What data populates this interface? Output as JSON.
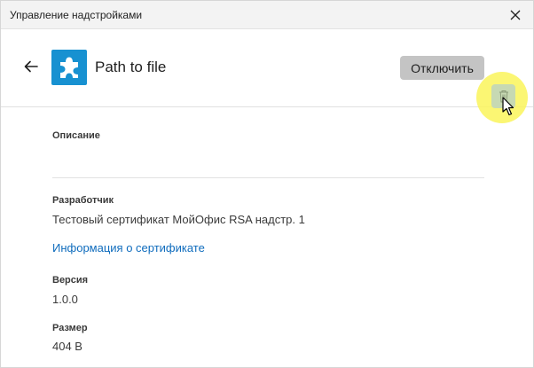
{
  "window": {
    "title": "Управление надстройками"
  },
  "header": {
    "addin_name": "Path to file",
    "disable_label": "Отключить"
  },
  "details": {
    "description_label": "Описание",
    "description_value": "",
    "developer_label": "Разработчик",
    "developer_value": "Тестовый сертификат МойОфис RSA надстр. 1",
    "certificate_link": "Информация о сертификате",
    "version_label": "Версия",
    "version_value": "1.0.0",
    "size_label": "Размер",
    "size_value": "404 B"
  },
  "icons": {
    "close": "close-icon",
    "back": "arrow-left-icon",
    "addin": "puzzle-piece-icon",
    "delete": "trash-icon",
    "cursor": "mouse-pointer-icon"
  },
  "colors": {
    "accent": "#1791d1",
    "link": "#0f6cbd",
    "disable_button": "#c4c4c4",
    "delete_button": "#c7d9b3",
    "click_highlight": "#faf55a"
  }
}
